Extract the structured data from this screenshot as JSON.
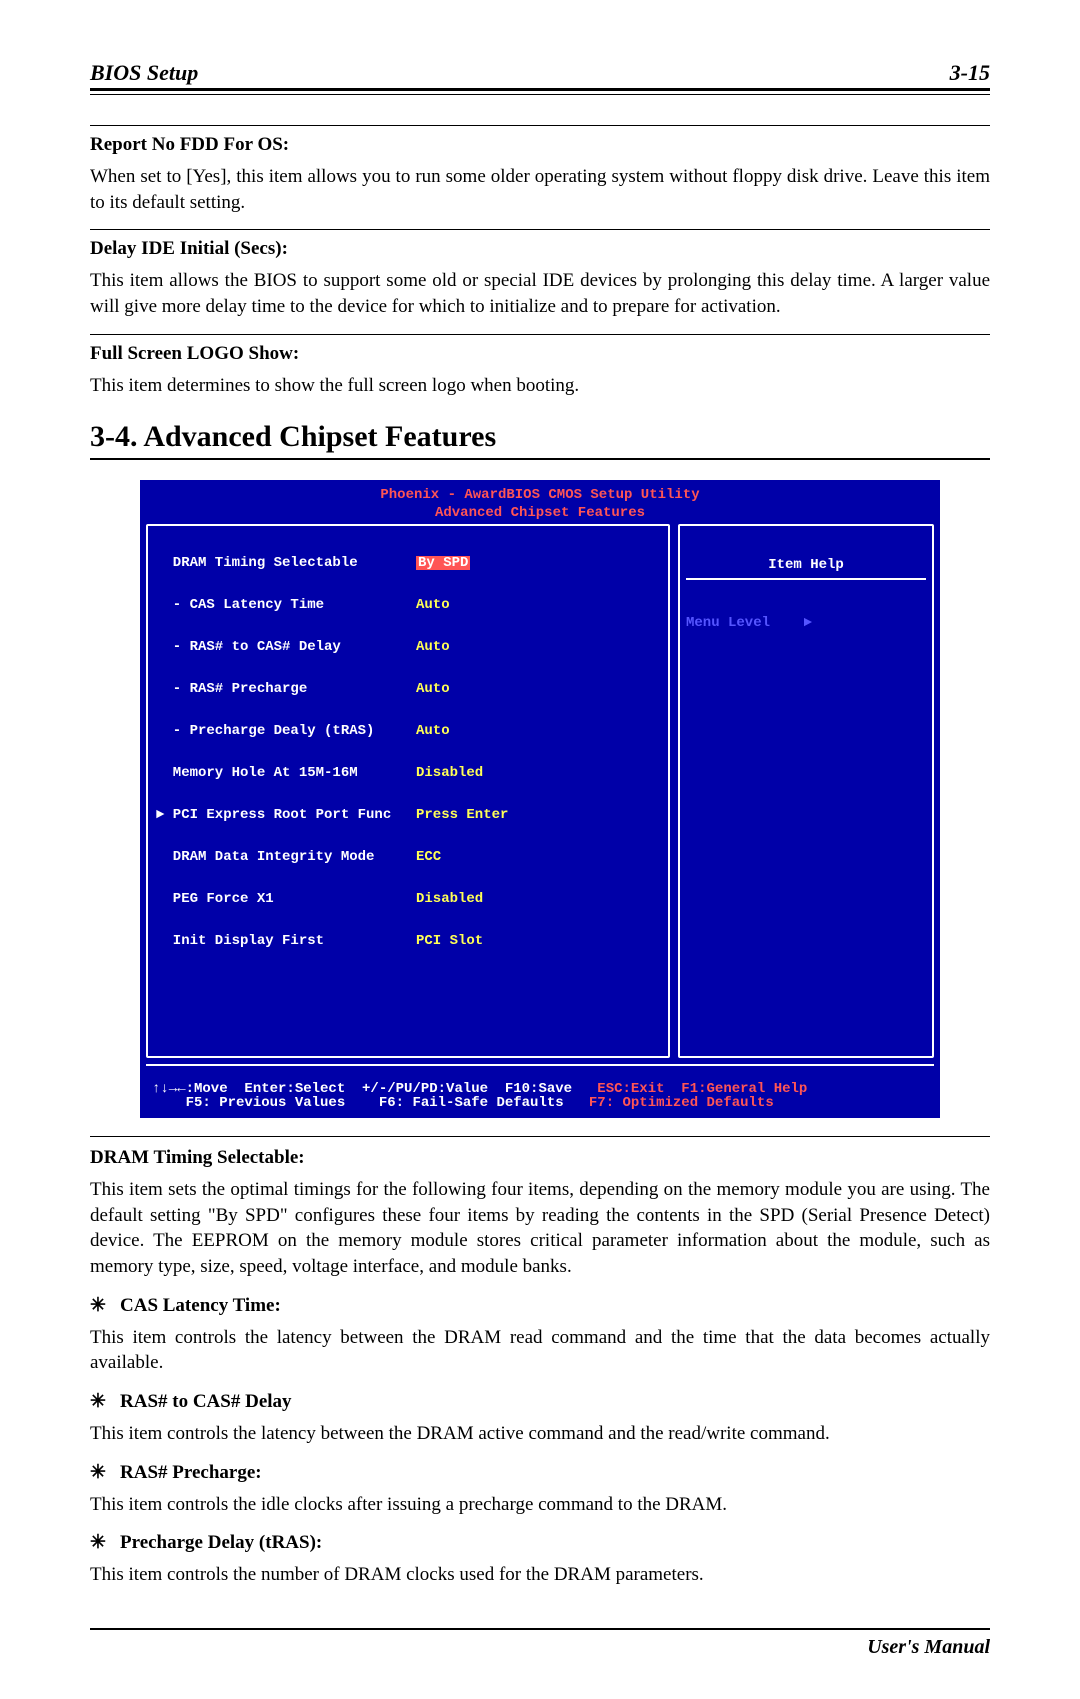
{
  "header": {
    "left": "BIOS Setup",
    "right": "3-15"
  },
  "sec1": {
    "h1": "Report No FDD For OS:",
    "p1": "When set to [Yes], this item allows you to run some older operating system without floppy disk drive. Leave this item to its default setting.",
    "h2": "Delay IDE Initial (Secs):",
    "p2": "This item allows the BIOS to support some old or special IDE devices by prolonging this delay time. A larger value will give more delay time to the device for which to initialize and to prepare for activation.",
    "h3": "Full Screen LOGO Show:",
    "p3": "This item determines to show the full screen logo when booting."
  },
  "section_title": "3-4.  Advanced Chipset Features",
  "bios": {
    "title1": "Phoenix - AwardBIOS CMOS Setup Utility",
    "title2": "Advanced Chipset Features",
    "items": [
      {
        "label": "  DRAM Timing Selectable",
        "value": "By SPD",
        "highlight": true
      },
      {
        "label": "  - CAS Latency Time",
        "value": "Auto"
      },
      {
        "label": "  - RAS# to CAS# Delay",
        "value": "Auto"
      },
      {
        "label": "  - RAS# Precharge",
        "value": "Auto"
      },
      {
        "label": "  - Precharge Dealy (tRAS)",
        "value": "Auto"
      },
      {
        "label": "  Memory Hole At 15M-16M",
        "value": "Disabled"
      },
      {
        "label": "► PCI Express Root Port Func",
        "value": "Press Enter"
      },
      {
        "label": "  DRAM Data Integrity Mode",
        "value": "ECC"
      },
      {
        "label": "  PEG Force X1",
        "value": "Disabled"
      },
      {
        "label": "  Init Display First",
        "value": "PCI Slot"
      }
    ],
    "help_title": "Item Help",
    "menu_level": "Menu Level    ►",
    "foot1_left": "↑↓→←:Move  Enter:Select  +/-/PU/PD:Value  F10:Save",
    "foot1_right": "ESC:Exit  F1:General Help",
    "foot2_left": "    F5: Previous Values    F6: Fail-Safe Defaults",
    "foot2_right": "F7: Optimized Defaults"
  },
  "sec2": {
    "h1": "DRAM Timing Selectable:",
    "p1": "This item sets the optimal timings for the following four items, depending on the memory module you are using. The default setting \"By SPD\" configures these four items by reading the contents in the SPD (Serial Presence Detect) device. The EEPROM on the memory module stores critical parameter information about the module, such as memory type, size, speed, voltage interface, and module banks.",
    "b1h": "CAS Latency Time:",
    "b1p": "This item controls the latency between the DRAM read command and the time that the data becomes actually available.",
    "b2h": "RAS# to CAS# Delay",
    "b2p": "This item controls the latency between the DRAM active command and the read/write command.",
    "b3h": "RAS# Precharge:",
    "b3p": "This item controls the idle clocks after issuing a precharge command to the DRAM.",
    "b4h": "Precharge Delay (tRAS):",
    "b4p": "This item controls the number of DRAM clocks used for the DRAM parameters."
  },
  "footer": "User's Manual",
  "glyphs": {
    "ast": "✳"
  }
}
